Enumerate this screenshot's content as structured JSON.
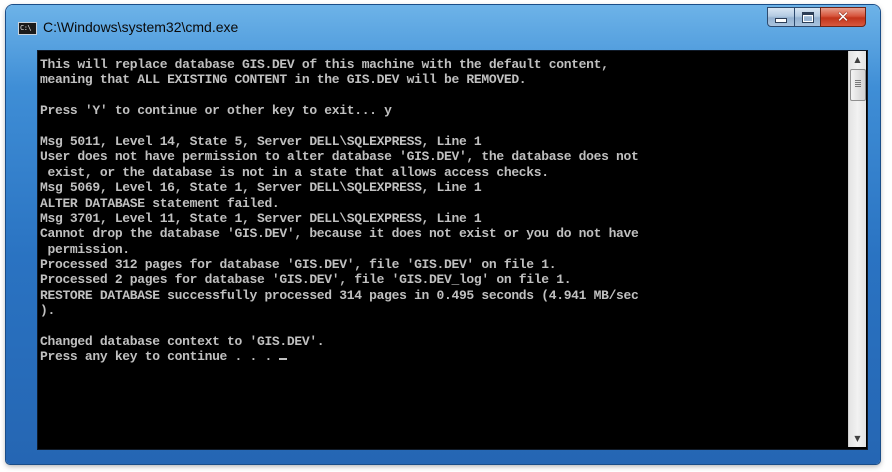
{
  "window": {
    "title": "C:\\Windows\\system32\\cmd.exe",
    "icon_label": "C:\\",
    "icons": {
      "app": "cmd-icon",
      "minimize": "minimize-icon",
      "maximize": "maximize-icon",
      "close": "close-icon",
      "scroll_up": "scroll-up-arrow-icon",
      "scroll_down": "scroll-down-arrow-icon"
    },
    "colors": {
      "titlebar": "#2a73c2",
      "close_button": "#c2341a",
      "console_background": "#000000",
      "console_text": "#c0c0c0"
    }
  },
  "console": {
    "lines": [
      "This will replace database GIS.DEV of this machine with the default content,",
      "meaning that ALL EXISTING CONTENT in the GIS.DEV will be REMOVED.",
      "",
      "Press 'Y' to continue or other key to exit... y",
      "",
      "Msg 5011, Level 14, State 5, Server DELL\\SQLEXPRESS, Line 1",
      "User does not have permission to alter database 'GIS.DEV', the database does not",
      " exist, or the database is not in a state that allows access checks.",
      "Msg 5069, Level 16, State 1, Server DELL\\SQLEXPRESS, Line 1",
      "ALTER DATABASE statement failed.",
      "Msg 3701, Level 11, State 1, Server DELL\\SQLEXPRESS, Line 1",
      "Cannot drop the database 'GIS.DEV', because it does not exist or you do not have",
      " permission.",
      "Processed 312 pages for database 'GIS.DEV', file 'GIS.DEV' on file 1.",
      "Processed 2 pages for database 'GIS.DEV', file 'GIS.DEV_log' on file 1.",
      "RESTORE DATABASE successfully processed 314 pages in 0.495 seconds (4.941 MB/sec",
      ").",
      "",
      "Changed database context to 'GIS.DEV'.",
      "Press any key to continue . . . "
    ]
  }
}
